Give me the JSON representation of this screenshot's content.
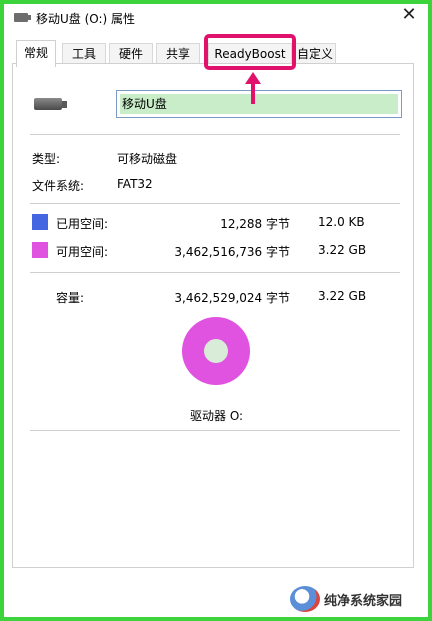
{
  "window": {
    "title": "移动U盘 (O:) 属性",
    "close_glyph": "✕"
  },
  "tabs": [
    {
      "label": "常规",
      "active": true
    },
    {
      "label": "工具"
    },
    {
      "label": "硬件"
    },
    {
      "label": "共享"
    },
    {
      "label": "ReadyBoost",
      "highlighted": true
    },
    {
      "label": "自定义"
    }
  ],
  "general": {
    "drive_name": "移动U盘",
    "type_label": "类型:",
    "type_value": "可移动磁盘",
    "fs_label": "文件系统:",
    "fs_value": "FAT32",
    "used_label": "已用空间:",
    "used_bytes": "12,288 字节",
    "used_size": "12.0 KB",
    "free_label": "可用空间:",
    "free_bytes": "3,462,516,736 字节",
    "free_size": "3.22 GB",
    "capacity_label": "容量:",
    "capacity_bytes": "3,462,529,024 字节",
    "capacity_size": "3.22 GB",
    "drive_label": "驱动器 O:"
  },
  "colors": {
    "used": "#4466e0",
    "free": "#e052e0",
    "highlight": "#e0126c",
    "border_green": "#3cd33c"
  },
  "watermark": {
    "text": "纯净系统家园"
  }
}
